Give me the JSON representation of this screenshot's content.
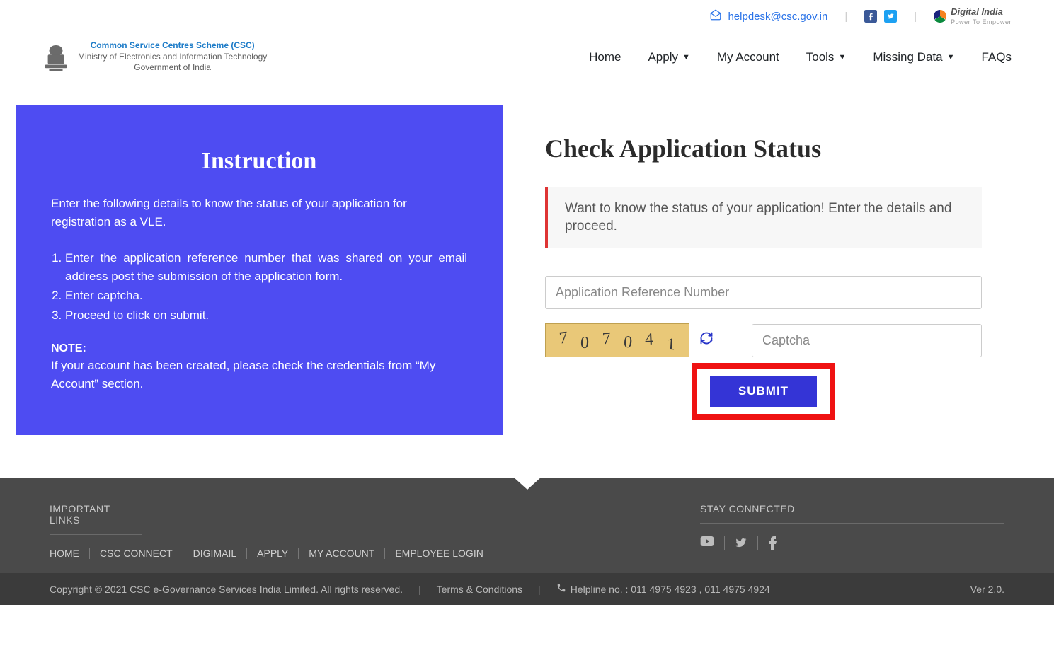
{
  "topbar": {
    "email": "helpdesk@csc.gov.in",
    "digital_india": {
      "title": "Digital India",
      "subtitle": "Power To Empower"
    }
  },
  "brand": {
    "line1": "Common Service Centres Scheme (CSC)",
    "line2": "Ministry of Electronics and Information Technology",
    "line3": "Government of India"
  },
  "nav": {
    "home": "Home",
    "apply": "Apply",
    "my_account": "My Account",
    "tools": "Tools",
    "missing_data": "Missing Data",
    "faqs": "FAQs"
  },
  "instruction": {
    "heading": "Instruction",
    "intro": "Enter the following details to know the status of your application for registration as a VLE.",
    "steps": [
      "Enter the application reference number that was shared on your email address post the submission of the application form.",
      "Enter captcha.",
      "Proceed to click on submit."
    ],
    "note_label": "NOTE:",
    "note_text": "If your account has been created, please check the credentials from “My Account” section."
  },
  "status": {
    "heading": "Check Application Status",
    "alert": "Want to know the status of your application! Enter the details and proceed.",
    "ref_placeholder": "Application Reference Number",
    "captcha_value": "707041",
    "captcha_placeholder": "Captcha",
    "submit": "SUBMIT"
  },
  "footer": {
    "important_links_title": "IMPORTANT LINKS",
    "links": [
      "HOME",
      "CSC CONNECT",
      "DIGIMAIL",
      "APPLY",
      "MY ACCOUNT",
      "EMPLOYEE LOGIN"
    ],
    "stay_connected_title": "STAY CONNECTED"
  },
  "bottombar": {
    "copyright_prefix": "Copyright ",
    "copyright_text": " 2021 CSC e-Governance Services India Limited. All rights reserved.",
    "terms": "Terms & Conditions",
    "helpline": "Helpline no. : 011 4975 4923 , 011 4975 4924",
    "version": "Ver 2.0."
  }
}
